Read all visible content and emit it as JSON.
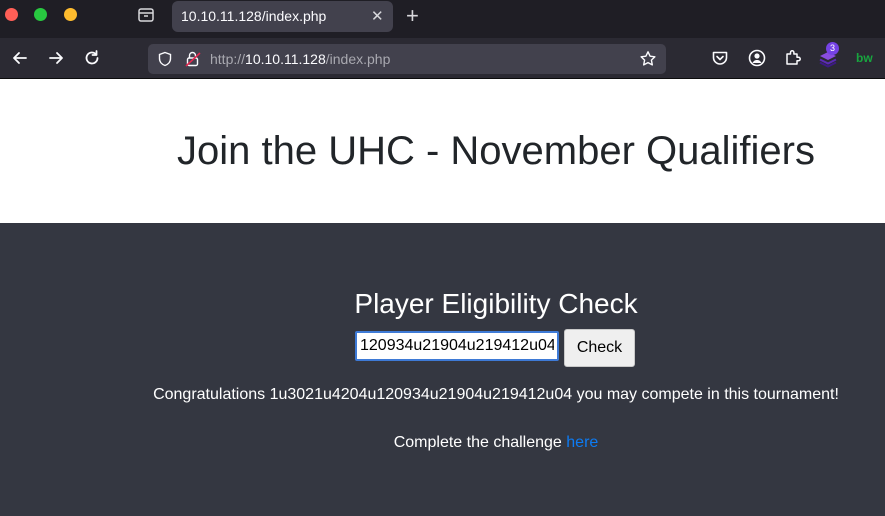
{
  "colors": {
    "close_dot": "#ff5f57",
    "zoom_dot": "#28c840",
    "minimize_dot": "#febc2e",
    "page_dark_bg": "#343741",
    "link": "#0d7bf2"
  },
  "browser": {
    "tab_title": "10.10.11.128/index.php",
    "url_scheme": "http://",
    "url_host": "10.10.11.128",
    "url_path": "/index.php",
    "extension_badge": "3",
    "bw_label": "bw"
  },
  "icons": [
    "tab-overview-icon",
    "close-icon",
    "plus-icon",
    "back-arrow-icon",
    "forward-arrow-icon",
    "reload-icon",
    "shield-icon",
    "insecure-lock-icon",
    "star-icon",
    "pocket-icon",
    "account-icon",
    "extensions-icon",
    "layers-extension-icon",
    "bitwarden-icon"
  ],
  "page": {
    "title": "Join the UHC - November Qualifiers",
    "form_heading": "Player Eligibility Check",
    "input_value": "120934u21904u219412u04",
    "check_button": "Check",
    "result_message": "Congratulations 1u3021u4204u120934u21904u219412u04 you may compete in this tournament!",
    "challenge_text": "Complete the challenge ",
    "challenge_link": "here"
  }
}
